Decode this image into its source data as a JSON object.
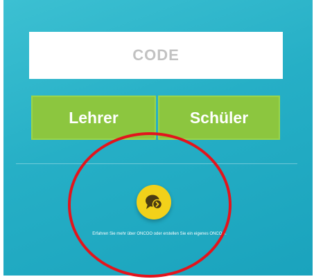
{
  "code_field": {
    "placeholder": "CODE",
    "value": ""
  },
  "roles": {
    "teacher_label": "Lehrer",
    "student_label": "Schüler"
  },
  "fab": {
    "icon": "chat-bubble-arrow-icon"
  },
  "info_text": "Erfahren Sie mehr über ONCOO oder erstellen Sie ein eigenes ONCOO.",
  "colors": {
    "panel": "#26afc6",
    "button": "#8cc63f",
    "fab": "#f2d11a",
    "highlight": "#e3141c"
  }
}
